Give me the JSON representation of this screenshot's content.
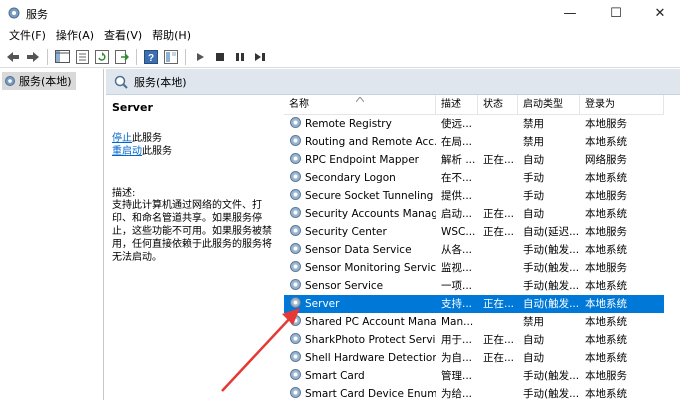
{
  "window": {
    "title": "服务",
    "min_label": "—",
    "max_label": "☐",
    "close_label": "✕"
  },
  "menu": [
    "文件(F)",
    "操作(A)",
    "查看(V)",
    "帮助(H)"
  ],
  "toolbar_icons": [
    "back-icon",
    "forward-icon",
    "console-tree-icon",
    "properties-icon",
    "refresh-icon",
    "export-icon",
    "help-icon",
    "view-icon",
    "start-icon",
    "stop-icon",
    "pause-icon",
    "restart-icon"
  ],
  "tree": {
    "root_label": "服务(本地)"
  },
  "panel": {
    "header": "服务(本地)"
  },
  "detail": {
    "service_name": "Server",
    "stop_link": "停止",
    "stop_suffix": "此服务",
    "restart_link": "重启动",
    "restart_suffix": "此服务",
    "desc_title": "描述:",
    "desc_text": "支持此计算机通过网络的文件、打印、和命名管道共享。如果服务停止，这些功能不可用。如果服务被禁用，任何直接依赖于此服务的服务将无法启动。"
  },
  "columns": {
    "name": "名称",
    "desc": "描述",
    "status": "状态",
    "startup": "启动类型",
    "logon": "登录为"
  },
  "rows": [
    {
      "name": "Remote Registry",
      "desc": "使远...",
      "status": "",
      "startup": "禁用",
      "logon": "本地服务"
    },
    {
      "name": "Routing and Remote Acc...",
      "desc": "在局...",
      "status": "",
      "startup": "禁用",
      "logon": "本地系统"
    },
    {
      "name": "RPC Endpoint Mapper",
      "desc": "解析 ...",
      "status": "正在...",
      "startup": "自动",
      "logon": "网络服务"
    },
    {
      "name": "Secondary Logon",
      "desc": "在不...",
      "status": "",
      "startup": "手动",
      "logon": "本地系统"
    },
    {
      "name": "Secure Socket Tunneling ...",
      "desc": "提供...",
      "status": "",
      "startup": "手动",
      "logon": "本地服务"
    },
    {
      "name": "Security Accounts Manag...",
      "desc": "启动...",
      "status": "正在...",
      "startup": "自动",
      "logon": "本地系统"
    },
    {
      "name": "Security Center",
      "desc": "WSC...",
      "status": "正在...",
      "startup": "自动(延迟...",
      "logon": "本地服务"
    },
    {
      "name": "Sensor Data Service",
      "desc": "从各...",
      "status": "",
      "startup": "手动(触发...",
      "logon": "本地系统"
    },
    {
      "name": "Sensor Monitoring Service",
      "desc": "监视...",
      "status": "",
      "startup": "手动(触发...",
      "logon": "本地服务"
    },
    {
      "name": "Sensor Service",
      "desc": "一项...",
      "status": "",
      "startup": "手动(触发...",
      "logon": "本地系统"
    },
    {
      "name": "Server",
      "desc": "支持...",
      "status": "正在...",
      "startup": "自动(触发...",
      "logon": "本地系统",
      "selected": true
    },
    {
      "name": "Shared PC Account Mana...",
      "desc": "Man...",
      "status": "",
      "startup": "禁用",
      "logon": "本地系统"
    },
    {
      "name": "SharkPhoto Protect Servi...",
      "desc": "用于...",
      "status": "正在...",
      "startup": "自动",
      "logon": "本地系统"
    },
    {
      "name": "Shell Hardware Detection",
      "desc": "为自...",
      "status": "正在...",
      "startup": "自动",
      "logon": "本地系统"
    },
    {
      "name": "Smart Card",
      "desc": "管理...",
      "status": "",
      "startup": "手动(触发...",
      "logon": "本地服务"
    },
    {
      "name": "Smart Card Device Enum...",
      "desc": "为给...",
      "status": "",
      "startup": "手动(触发...",
      "logon": "本地系统"
    }
  ],
  "colors": {
    "accent": "#0078d7",
    "header_bg": "#dfe6ee",
    "annotation_arrow": "#e53935"
  }
}
